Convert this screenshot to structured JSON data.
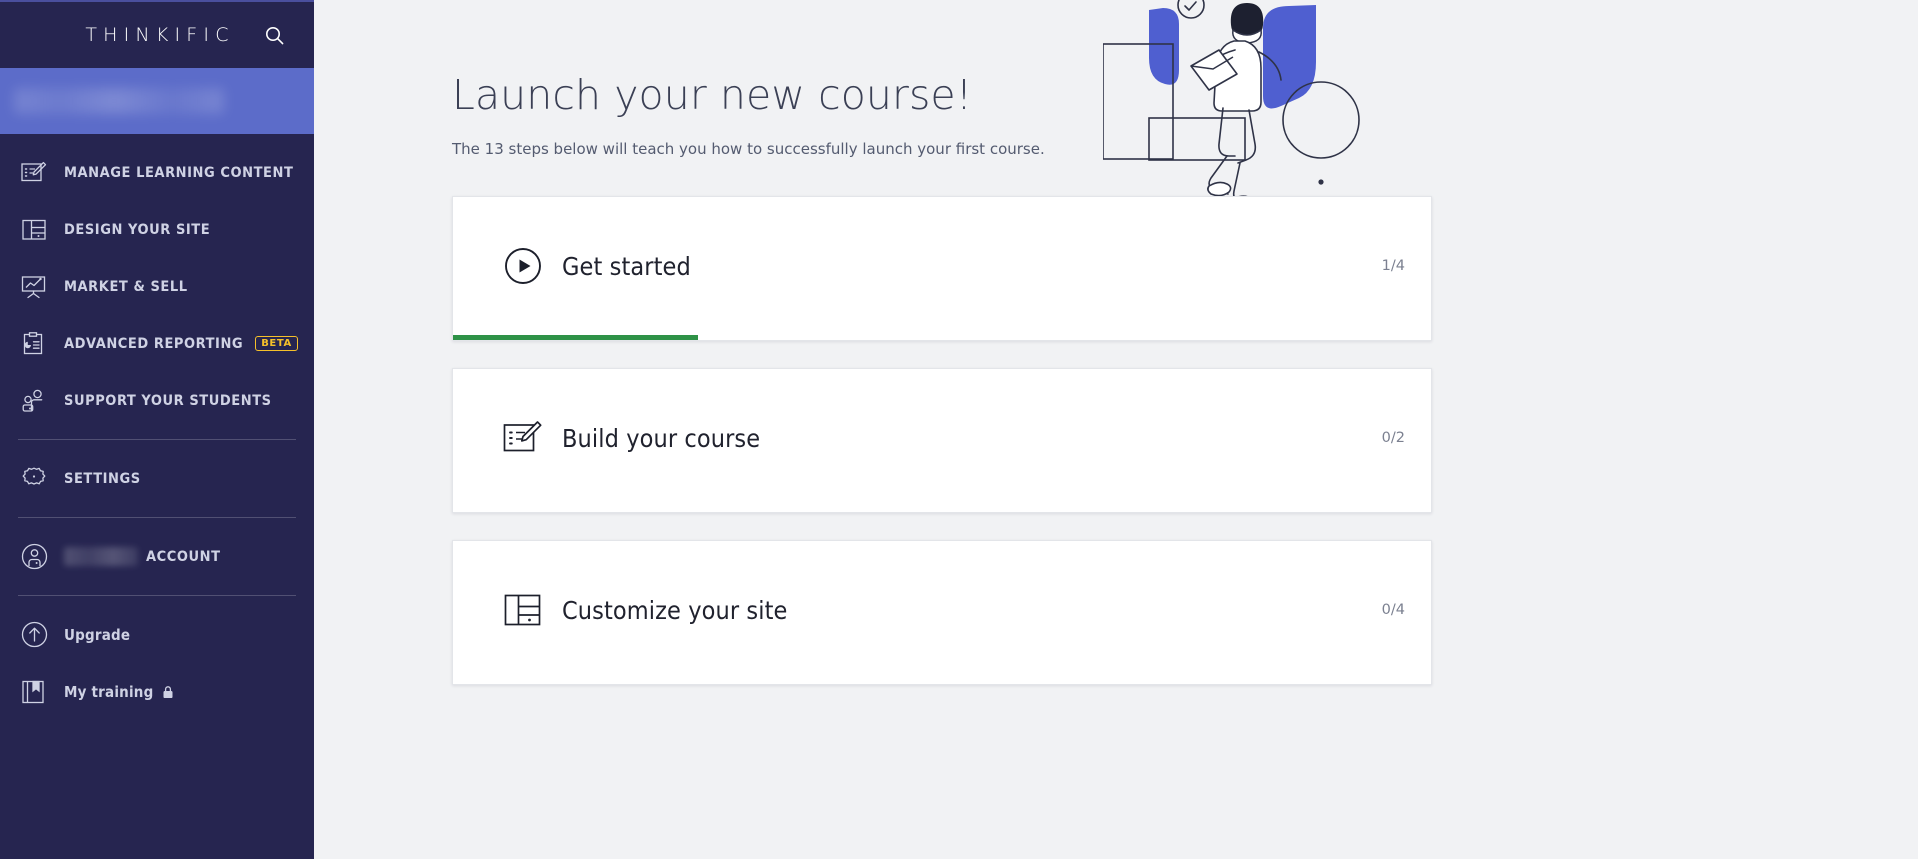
{
  "sidebar": {
    "logo": "THINKIFIC",
    "search_icon": "search-icon",
    "site_name_redacted": "",
    "nav": [
      {
        "label": "MANAGE LEARNING CONTENT",
        "icon": "edit-document-icon",
        "badge": null
      },
      {
        "label": "DESIGN YOUR SITE",
        "icon": "layout-panels-icon",
        "badge": null
      },
      {
        "label": "MARKET & SELL",
        "icon": "presentation-chart-icon",
        "badge": null
      },
      {
        "label": "ADVANCED REPORTING",
        "icon": "clipboard-report-icon",
        "badge": "BETA"
      },
      {
        "label": "SUPPORT YOUR STUDENTS",
        "icon": "people-icon",
        "badge": null
      }
    ],
    "settings": {
      "label": "SETTINGS",
      "icon": "gear-icon"
    },
    "account": {
      "label": "ACCOUNT",
      "icon": "user-circle-icon",
      "name_redacted": ""
    },
    "footer": [
      {
        "label": "Upgrade",
        "icon": "arrow-up-circle-icon",
        "locked": false
      },
      {
        "label": "My training",
        "icon": "book-bookmark-icon",
        "locked": true
      }
    ],
    "colors": {
      "background": "#262550",
      "site_block": "#5c6cc9",
      "label": "#cfd2e4",
      "beta": "#f5c02a"
    }
  },
  "main": {
    "title": "Launch your new course!",
    "subtitle": "The 13 steps below will teach you how to successfully launch your first course.",
    "total_steps": 13,
    "illustration": "person-at-desk-illustration",
    "colors": {
      "background": "#f1f2f4",
      "heading": "#3b4055",
      "progress": "#2e9247"
    },
    "cards": [
      {
        "title": "Get started",
        "icon": "play-circle-icon",
        "count": "1/4",
        "completed": 1,
        "total": 4,
        "progress_percent": 25
      },
      {
        "title": "Build your course",
        "icon": "edit-document-icon",
        "count": "0/2",
        "completed": 0,
        "total": 2,
        "progress_percent": 0
      },
      {
        "title": "Customize your site",
        "icon": "layout-panels-icon",
        "count": "0/4",
        "completed": 0,
        "total": 4,
        "progress_percent": 0
      }
    ]
  }
}
